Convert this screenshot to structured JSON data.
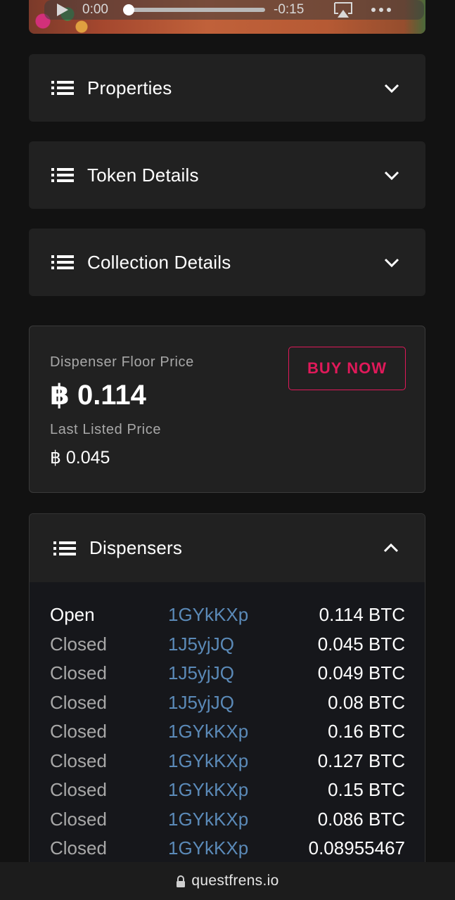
{
  "player": {
    "current_time": "0:00",
    "remaining_time": "-0:15",
    "progress": 0.0,
    "icons": [
      "play-icon",
      "airplay-icon",
      "more-icon"
    ]
  },
  "accordions": [
    {
      "title": "Properties",
      "icon": "list-icon",
      "state": "collapsed"
    },
    {
      "title": "Token Details",
      "icon": "list-icon",
      "state": "collapsed"
    },
    {
      "title": "Collection Details",
      "icon": "list-icon",
      "state": "collapsed"
    }
  ],
  "price": {
    "floor_label": "Dispenser Floor Price",
    "floor_value": "฿ 0.114",
    "last_label": "Last Listed Price",
    "last_value": "฿ 0.045",
    "buy_label": "BUY NOW"
  },
  "dispensers": {
    "title": "Dispensers",
    "state": "expanded",
    "rows": [
      {
        "status": "Open",
        "address": "1GYkKXp",
        "amount": "0.114 BTC"
      },
      {
        "status": "Closed",
        "address": "1J5yjJQ",
        "amount": "0.045 BTC"
      },
      {
        "status": "Closed",
        "address": "1J5yjJQ",
        "amount": "0.049 BTC"
      },
      {
        "status": "Closed",
        "address": "1J5yjJQ",
        "amount": "0.08 BTC"
      },
      {
        "status": "Closed",
        "address": "1GYkKXp",
        "amount": "0.16 BTC"
      },
      {
        "status": "Closed",
        "address": "1GYkKXp",
        "amount": "0.127 BTC"
      },
      {
        "status": "Closed",
        "address": "1GYkKXp",
        "amount": "0.15 BTC"
      },
      {
        "status": "Closed",
        "address": "1GYkKXp",
        "amount": "0.086 BTC"
      },
      {
        "status": "Closed",
        "address": "1GYkKXp",
        "amount": "0.08955467"
      }
    ]
  },
  "browser": {
    "url": "questfrens.io",
    "icon": "lock-icon"
  },
  "colors": {
    "background": "#121212",
    "card": "#212121",
    "accent": "#e0195a",
    "link": "#5b8ab8"
  }
}
